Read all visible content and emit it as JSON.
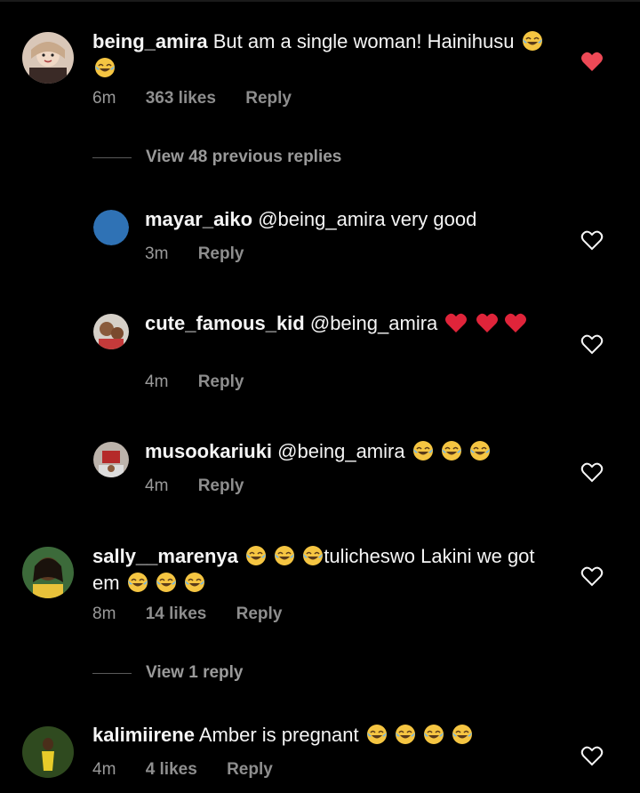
{
  "comments": [
    {
      "username": "being_amira",
      "text": "But am a single woman! Hainihusu",
      "emoji": "😂😂",
      "time": "6m",
      "likes": "363 likes",
      "reply": "Reply",
      "liked": true
    },
    {
      "username": "mayar_aiko",
      "text": "@being_amira very good",
      "time": "3m",
      "reply": "Reply",
      "liked": false
    },
    {
      "username": "cute_famous_kid",
      "text": "@being_amira",
      "emoji": "❤️❤️❤️",
      "time": "4m",
      "reply": "Reply",
      "liked": false
    },
    {
      "username": "musookariuki",
      "text": "@being_amira",
      "emoji": "😂😂😂",
      "time": "4m",
      "reply": "Reply",
      "liked": false
    },
    {
      "username": "sally__marenya",
      "text_a": "tulicheswo Lakini we got em",
      "emoji": "😂😂😂😂😂😂",
      "time": "8m",
      "likes": "14 likes",
      "reply": "Reply",
      "liked": false
    },
    {
      "username": "kalimiirene",
      "text": "Amber is pregnant",
      "emoji": "😂😂😂😂",
      "time": "4m",
      "likes": "4 likes",
      "reply": "Reply",
      "liked": false
    }
  ],
  "view_previous": "View 48 previous replies",
  "view_one": "View 1 reply",
  "colors": {
    "liked_heart": "#ed4956",
    "heart_outline": "#f5f5f5",
    "meta": "#8e8e8e"
  },
  "icons": {
    "liked": "heart-filled-icon",
    "unliked": "heart-outline-icon",
    "emoji": "tears-of-joy-emoji",
    "heart_emoji": "red-heart-emoji"
  }
}
